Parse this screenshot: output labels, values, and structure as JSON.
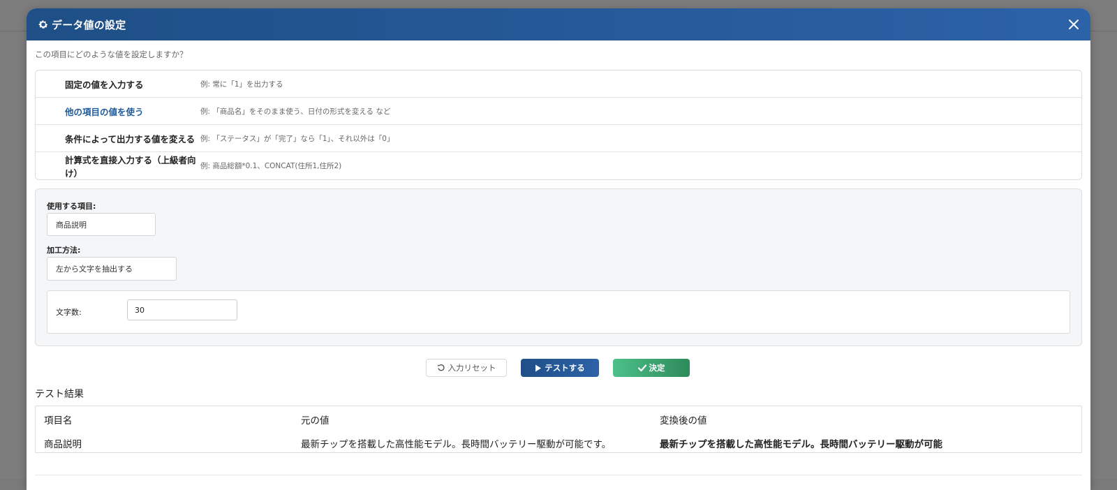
{
  "dialog": {
    "title": "データ値の設定",
    "icon": "gear-icon",
    "close_icon": "close-icon",
    "question": "この項目にどのような値を設定しますか？"
  },
  "options": [
    {
      "label": "固定の値を入力する",
      "example": "例: 常に「1」を出力する",
      "active": false
    },
    {
      "label": "他の項目の値を使う",
      "example": "例: 「商品名」をそのまま使う、日付の形式を変える など",
      "active": true
    },
    {
      "label": "条件によって出力する値を変える",
      "example": "例: 「ステータス」が「完了」なら「1」、それ以外は「0」",
      "active": false
    },
    {
      "label": "計算式を直接入力する（上級者向け）",
      "example": "例: 商品総額*0.1、CONCAT(住所1,住所2)",
      "active": false
    }
  ],
  "config": {
    "field_label": "使用する項目:",
    "field_value": "商品説明",
    "method_label": "加工方法:",
    "method_value": "左から文字を抽出する",
    "char_count_label": "文字数:",
    "char_count_value": "30"
  },
  "buttons": {
    "reset": "入力リセット",
    "test": "テストする",
    "ok": "決定"
  },
  "colors": {
    "header_start": "#1e4f86",
    "header_end": "#2c62a8",
    "active_option": "#1f5a9a",
    "ok_start": "#4cc08a",
    "ok_end": "#2e8a5a"
  },
  "result": {
    "title": "テスト結果",
    "headers": [
      "項目名",
      "元の値",
      "変換後の値"
    ],
    "row": [
      "商品説明",
      "最新チップを搭載した高性能モデル。長時間バッテリー駆動が可能です。",
      "最新チップを搭載した高性能モデル。長時間バッテリー駆動が可能"
    ]
  }
}
